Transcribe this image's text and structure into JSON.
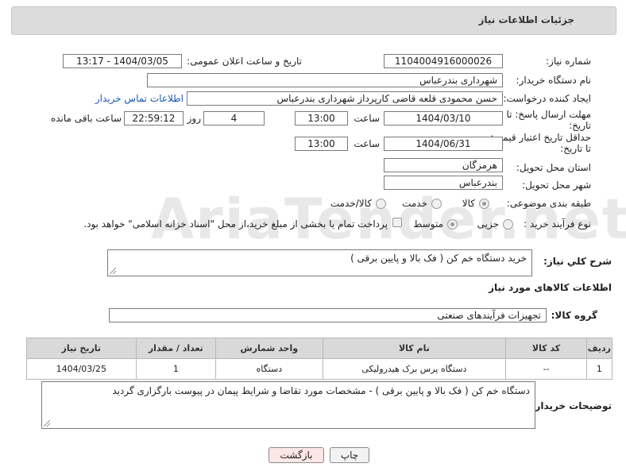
{
  "header": {
    "title": "جزئیات اطلاعات نیاز"
  },
  "watermark": "AriaTender.net",
  "form": {
    "need_number_label": "شماره نیاز:",
    "need_number": "1104004916000026",
    "announce_label": "تاریخ و ساعت اعلان عمومی:",
    "announce_value": "1404/03/05 - 13:17",
    "buyer_org_label": "نام دستگاه خریدار:",
    "buyer_org": "شهرداری بندرعباس",
    "creator_label": "ایجاد کننده درخواست:",
    "creator": "حسن محمودی قلعه قاضی کارپرداز شهرداری بندرعباس",
    "contact_link": "اطلاعات تماس خریدار",
    "deadline_label_1": "مهلت ارسال پاسخ: تا",
    "deadline_label_2": "تاریخ:",
    "deadline_date": "1404/03/10",
    "time_label": "ساعت",
    "deadline_time": "13:00",
    "days_value": "4",
    "days_label": "روز و",
    "remaining_time": "22:59:12",
    "remaining_label": "ساعت باقی مانده",
    "validity_label_1": "حداقل تاریخ اعتبار قیمت:",
    "validity_label_2": "تا تاریخ:",
    "validity_date": "1404/06/31",
    "validity_time": "13:00",
    "province_label": "استان محل تحویل:",
    "province": "هرمزگان",
    "city_label": "شهر محل تحویل:",
    "city": "بندرعباس",
    "category_label": "طبقه بندی موضوعی:",
    "category_options": [
      "کالا",
      "خدمت",
      "کالا/خدمت"
    ],
    "process_label": "نوع فرآیند خرید :",
    "process_options": [
      "جزیی",
      "متوسط"
    ],
    "payment_note": "پرداخت تمام یا بخشی از مبلغ خرید،از محل \"اسناد خزانه اسلامی\" خواهد بود."
  },
  "description": {
    "label": "شرح كلي نياز:",
    "value": "خرید دستگاه  خم کن ( فک بالا و پایین برقی )"
  },
  "goods": {
    "section_title": "اطلاعات کالاهای مورد نیاز",
    "group_label": "گروه کالا:",
    "group_value": "تجهیزات فرآیندهای صنعتی",
    "columns": [
      "ردیف",
      "کد کالا",
      "نام کالا",
      "واحد شمارش",
      "تعداد / مقدار",
      "تاریخ نیاز"
    ],
    "rows": [
      [
        "1",
        "--",
        "دستگاه پرس برک هیدرولیکی",
        "دستگاه",
        "1",
        "1404/03/25"
      ]
    ]
  },
  "buyer_notes": {
    "label": "توضیحات خریدار:",
    "value": "دستگاه  خم کن ( فک بالا و پایین برقی ) - مشخصات مورد تقاضا و شرایط پیمان در پیوست بارگزاری گردید"
  },
  "buttons": {
    "print": "چاپ",
    "back": "بازگشت"
  },
  "colors": {
    "link": "#1a56b0",
    "back_button_bg": "#fde6e6",
    "table_header_bg": "#d9d9d9"
  }
}
